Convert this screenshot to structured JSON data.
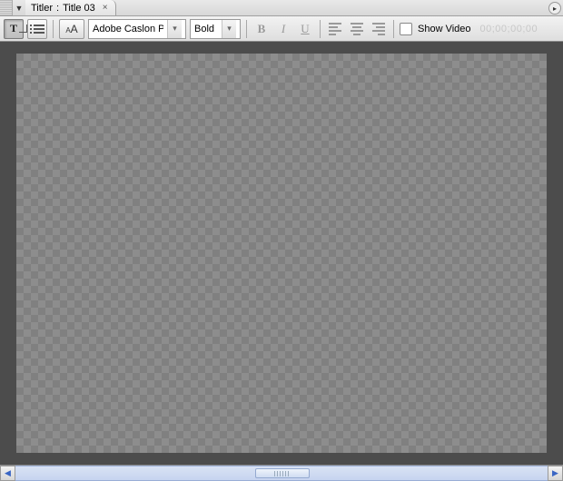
{
  "tab": {
    "panel_label": "Titler",
    "title": "Title 03"
  },
  "toolbar": {
    "font_family": "Adobe Caslon Pro",
    "font_weight": "Bold",
    "bold_glyph": "B",
    "italic_glyph": "I",
    "underline_glyph": "U",
    "show_video_label": "Show Video",
    "timecode": "00;00;00;00"
  },
  "icons": {
    "text_tool": "T",
    "font_size_small": "A",
    "font_size_large": "A"
  }
}
